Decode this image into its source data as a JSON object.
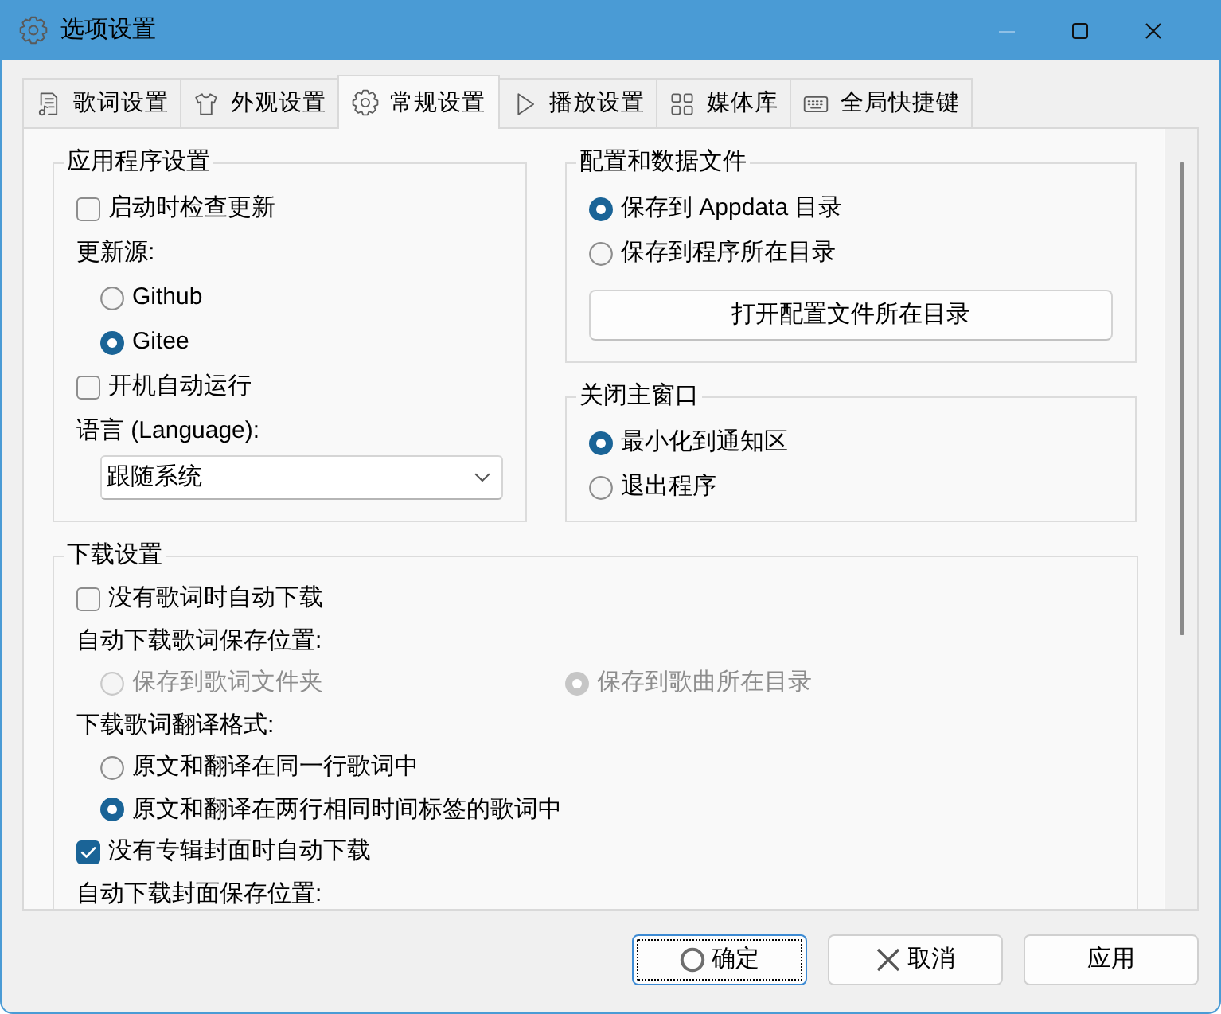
{
  "window": {
    "title": "选项设置",
    "controls": [
      {
        "kind": "minimize",
        "disabled": true
      },
      {
        "kind": "maximize",
        "disabled": false
      },
      {
        "kind": "close",
        "disabled": false
      }
    ]
  },
  "tabs": [
    {
      "label": "歌词设置",
      "kind": "lyrics",
      "selected": false
    },
    {
      "label": "外观设置",
      "kind": "appearance",
      "selected": false
    },
    {
      "label": "常规设置",
      "kind": "general",
      "selected": true
    },
    {
      "label": "播放设置",
      "kind": "playback",
      "selected": false
    },
    {
      "label": "媒体库",
      "kind": "library",
      "selected": false
    },
    {
      "label": "全局快捷键",
      "kind": "hotkeys",
      "selected": false
    }
  ],
  "groups": [
    {
      "title": "应用程序设置",
      "items": [
        {
          "kind": "checkbox",
          "label": "启动时检查更新",
          "checked": false,
          "disabled": false
        },
        {
          "kind": "label",
          "text": "更新源:",
          "children": [
            {
              "kind": "radio",
              "label": "Github",
              "selected": false,
              "disabled": false
            },
            {
              "kind": "radio",
              "label": "Gitee",
              "selected": true,
              "disabled": false
            }
          ]
        },
        {
          "kind": "checkbox",
          "label": "开机自动运行",
          "checked": false,
          "disabled": false
        },
        {
          "kind": "label",
          "text": "语言 (Language):",
          "children": [
            {
              "kind": "dropdown",
              "value": "跟随系统"
            }
          ]
        }
      ]
    },
    {
      "title": "配置和数据文件",
      "items": [
        {
          "kind": "radio",
          "label": "保存到 Appdata 目录",
          "selected": true,
          "disabled": false
        },
        {
          "kind": "radio",
          "label": "保存到程序所在目录",
          "selected": false,
          "disabled": false
        },
        {
          "kind": "button",
          "label": "打开配置文件所在目录"
        }
      ]
    },
    {
      "title": "关闭主窗口",
      "items": [
        {
          "kind": "radio",
          "label": "最小化到通知区",
          "selected": true,
          "disabled": false
        },
        {
          "kind": "radio",
          "label": "退出程序",
          "selected": false,
          "disabled": false
        }
      ]
    },
    {
      "title": "下载设置",
      "items": [
        {
          "kind": "checkbox",
          "label": "没有歌词时自动下载",
          "checked": false,
          "disabled": false
        },
        {
          "kind": "label",
          "text": "自动下载歌词保存位置:",
          "children": [
            {
              "kind": "radio_row",
              "options": [
                {
                  "label": "保存到歌词文件夹",
                  "selected": false,
                  "disabled": true
                },
                {
                  "label": "保存到歌曲所在目录",
                  "selected": true,
                  "disabled": true
                }
              ]
            }
          ]
        },
        {
          "kind": "label",
          "text": "下载歌词翻译格式:",
          "children": [
            {
              "kind": "radio",
              "label": "原文和翻译在同一行歌词中",
              "selected": false,
              "disabled": false
            },
            {
              "kind": "radio",
              "label": "原文和翻译在两行相同时间标签的歌词中",
              "selected": true,
              "disabled": false
            }
          ]
        },
        {
          "kind": "checkbox",
          "label": "没有专辑封面时自动下载",
          "checked": true,
          "disabled": false
        },
        {
          "kind": "label",
          "text": "自动下载封面保存位置:"
        }
      ]
    }
  ],
  "buttons": [
    {
      "label": "确定",
      "kind": "ok",
      "focused": true
    },
    {
      "label": "取消",
      "kind": "cancel",
      "focused": false
    },
    {
      "label": "应用",
      "kind": "apply",
      "focused": false
    }
  ]
}
